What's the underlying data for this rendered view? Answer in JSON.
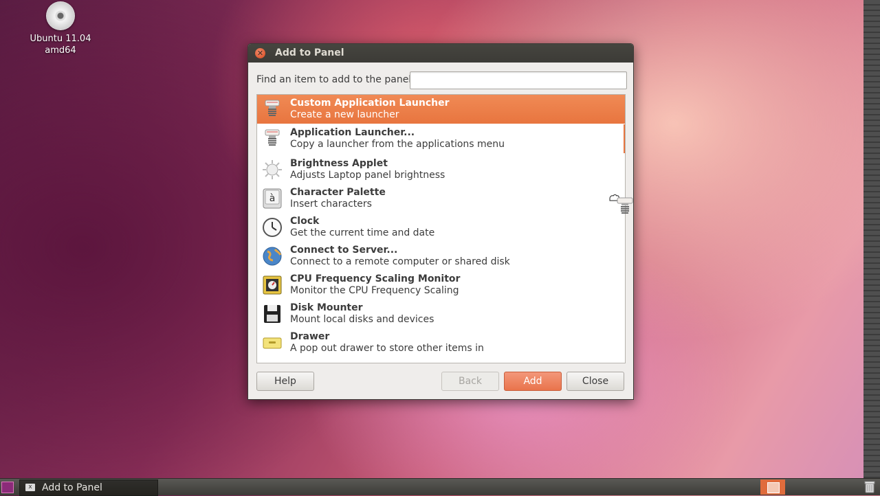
{
  "desktop": {
    "icon_label_line1": "Ubuntu 11.04",
    "icon_label_line2": "amd64"
  },
  "dialog": {
    "title": "Add to Panel",
    "find_label": "Find an item to add to the panel:",
    "find_value": "",
    "items": [
      {
        "name": "Custom Application Launcher",
        "desc": "Create a new launcher",
        "icon": "launcher-icon",
        "selected": true
      },
      {
        "name": "Application Launcher...",
        "desc": "Copy a launcher from the applications menu",
        "icon": "launcher-icon"
      },
      {
        "name": "Brightness Applet",
        "desc": "Adjusts Laptop panel brightness",
        "icon": "brightness-icon"
      },
      {
        "name": "Character Palette",
        "desc": "Insert characters",
        "icon": "character-palette-icon"
      },
      {
        "name": "Clock",
        "desc": "Get the current time and date",
        "icon": "clock-icon"
      },
      {
        "name": "Connect to Server...",
        "desc": "Connect to a remote computer or shared disk",
        "icon": "globe-icon"
      },
      {
        "name": "CPU Frequency Scaling Monitor",
        "desc": "Monitor the CPU Frequency Scaling",
        "icon": "cpu-icon"
      },
      {
        "name": "Disk Mounter",
        "desc": "Mount local disks and devices",
        "icon": "floppy-icon"
      },
      {
        "name": "Drawer",
        "desc": "A pop out drawer to store other items in",
        "icon": "drawer-icon"
      }
    ],
    "buttons": {
      "help": "Help",
      "back": "Back",
      "add": "Add",
      "close": "Close"
    }
  },
  "taskbar": {
    "task_label": "Add to Panel"
  },
  "colors": {
    "accent": "#e8753f",
    "titlebar": "#3c3b37",
    "dialog_bg": "#efedeb"
  }
}
